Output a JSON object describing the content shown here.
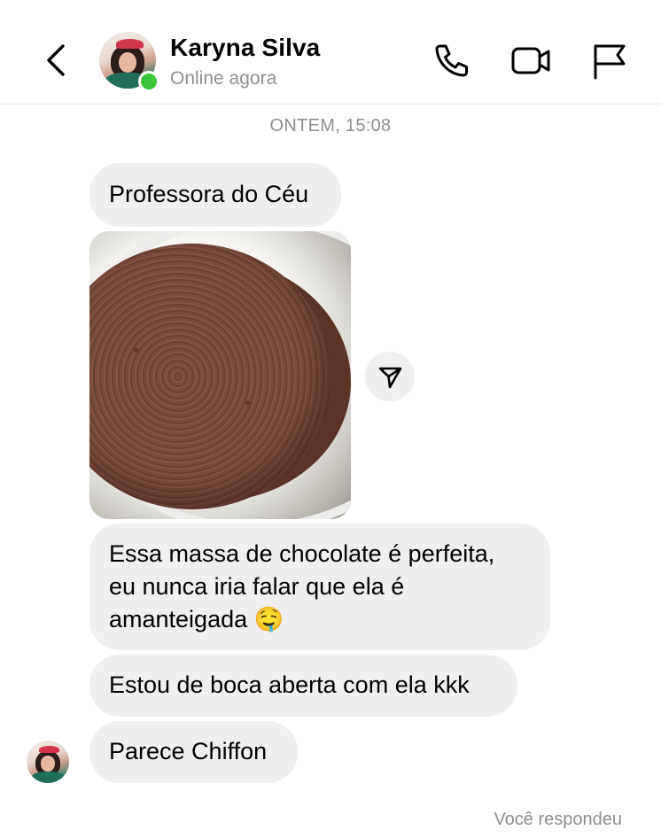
{
  "header": {
    "contact_name": "Karyna Silva",
    "status": "Online agora",
    "icons": [
      "chevron-left-icon",
      "phone-icon",
      "video-camera-icon",
      "flag-icon"
    ]
  },
  "conversation": {
    "timestamp": "ONTEM, 15:08",
    "messages": [
      {
        "type": "text",
        "text": "Professora do Céu"
      },
      {
        "type": "image",
        "alt": "chocolate sponge cake on a white plate"
      },
      {
        "type": "text",
        "text": "Essa massa de chocolate é perfeita,"
      },
      {
        "type": "text",
        "text": "eu nunca iria falar que ela é"
      },
      {
        "type": "text",
        "text": "amanteigada 🤤"
      },
      {
        "type": "text",
        "text": "Estou de boca aberta com ela kkk"
      },
      {
        "type": "text",
        "text": "Parece Chiffon"
      }
    ],
    "footer_note": "Você respondeu"
  },
  "colors": {
    "bubble": "#efefef",
    "secondary_text": "#8e8e8e",
    "online": "#3ac43a"
  }
}
